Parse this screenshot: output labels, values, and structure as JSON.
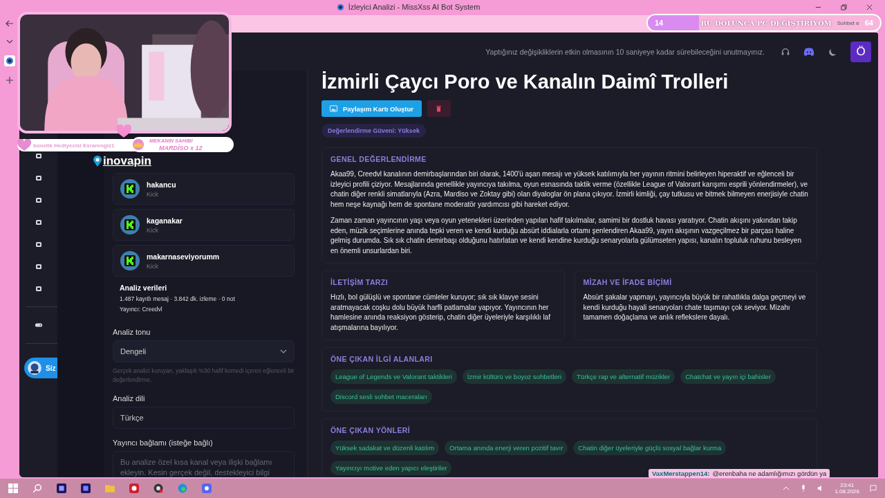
{
  "window": {
    "title": "İzleyici Analizi - MissXss AI Bot System"
  },
  "header": {
    "notice": "Yaptığınız değişikliklerin etkin olmasının 10 saniyeye kadar sürebileceğini unutmayınız.",
    "avatar_letter": "Ö"
  },
  "rail": {
    "user_label": "Siz"
  },
  "viewers": [
    {
      "name": "hakancu",
      "platform": "Kick",
      "selected": false
    },
    {
      "name": "kaganakar",
      "platform": "Kick",
      "selected": false
    },
    {
      "name": "makarnaseviyorumm",
      "platform": "Kick",
      "selected": false
    }
  ],
  "analysis_data": {
    "title": "Analiz verileri",
    "stats": "1.487 kayıtlı mesaj · 3.842 dk. izleme · 0 not",
    "streamer": "Yayıncı: Creedvl"
  },
  "tone": {
    "label": "Analiz tonu",
    "value": "Dengeli",
    "help": "Gerçek analizi koruyan, yaklaşık %30 hafif komedi içeren eğlenceli bir değerlendirme."
  },
  "language": {
    "label": "Analiz dili",
    "value": "Türkçe"
  },
  "context": {
    "label": "Yayıncı bağlamı (isteğe bağlı)",
    "placeholder": "Bu analize özel kısa kanal veya ilişki bağlamı ekleyin. Kesin gerçek değil, destekleyici bilgi"
  },
  "result": {
    "title": "İzmirli Çaycı Poro ve Kanalın Daimî Trolleri",
    "share_button": "Paylaşım Kartı Oluştur",
    "confidence": "Değerlendirme Güveni: Yüksek",
    "general": {
      "heading": "GENEL DEĞERLENDİRME",
      "paragraphs": [
        "Akaa99, Creedvl kanalının demirbaşlarından biri olarak, 1400'ü aşan mesajı ve yüksek katılımıyla her yayının ritmini belirleyen hiperaktif ve eğlenceli bir izleyici profili çiziyor. Mesajlarında genellikle yayıncıya takılma, oyun esnasında taktik verme (özellikle League of Valorant karışımı esprili yönlendirmeler), ve chatin diğer renkli simatlarıyla (Azra, Mardiso ve Zoktay gibi) olan diyaloglar ön plana çıkıyor. İzmirli kimliği, çay tutkusu ve bitmek bilmeyen enerjisiyle chatin hem neşe kaynağı hem de spontane moderatör yardımcısı gibi hareket ediyor.",
        "Zaman zaman yayıncının yaşı veya oyun yetenekleri üzerinden yapılan hafif takılmalar, samimi bir dostluk havası yaratıyor. Chatin akışını yakından takip eden, müzik seçimlerine anında tepki veren ve kendi kurduğu absürt iddialarla ortamı şenlendiren Akaa99, yayın akışının vazgeçilmez bir parçası haline gelmiş durumda. Sık sık chatin demirbaşı olduğunu hatırlatan ve kendi kendine kurduğu senaryolarla gülümseten yapısı, kanalın topluluk ruhunu besleyen en önemli unsurlardan biri."
      ]
    },
    "communication": {
      "heading": "İLETİŞİM TARZI",
      "text": "Hızlı, bol gülüşlü ve spontane cümleler kuruyor; sık sık klavye sesini aratmayacak coşku dolu büyük harfli patlamalar yapıyor. Yayıncının her hamlesine anında reaksiyon gösterip, chatin diğer üyeleriyle karşılıklı laf atışmalarına bayılıyor."
    },
    "humor": {
      "heading": "MİZAH VE İFADE BİÇİMİ",
      "text": "Absürt şakalar yapmayı, yayıncıyla büyük bir rahatlıkla dalga geçmeyi ve kendi kurduğu hayali senaryoları chate taşımayı çok seviyor. Mizahı tamamen doğaçlama ve anlık reflekslere dayalı."
    },
    "interests": {
      "heading": "ÖNE ÇIKAN İLGİ ALANLARI",
      "tags": [
        "League of Legends ve Valorant taktikleri",
        "İzmir kültürü ve boyoz sohbetleri",
        "Türkçe rap ve alternatif müzikler",
        "Chatchat ve yayın içi bahisler",
        "Discord sesli sohbet maceraları"
      ]
    },
    "strengths": {
      "heading": "ÖNE ÇIKAN YÖNLERİ",
      "tags": [
        "Yüksek sadakat ve düzenli katılım",
        "Ortama anında enerji veren pozitif tavır",
        "Chatin diğer üyeleriyle güçlü sosyal bağlar kurma",
        "Yayıncıyı motive eden yapıcı eleştiriler"
      ]
    }
  },
  "stream_overlay": {
    "sub_gift": "bonelik Hediyecisi Esrarengiz1",
    "owner_title": "MEKANIN SAHIBI",
    "owner_name": "MARDİSO x 12",
    "sponsor": "inovapin",
    "goal": {
      "current": "14",
      "text": "BU DOLUNCA PC DEĞİŞTİRİYOM",
      "target": "64",
      "level": 0.22
    },
    "chat_tab": "Sohbet e",
    "chat_user": "VaxMerstappen14:",
    "chat_message": "@erenbaha ne adamlığımızı gördün ya"
  },
  "taskbar": {
    "time": "23:41",
    "date": "1.08.2026"
  }
}
